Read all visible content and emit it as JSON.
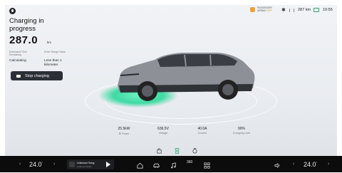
{
  "status": {
    "airbag_line1": "PASSENGER",
    "airbag_line2": "AIRBAG",
    "airbag_state": "OFF",
    "range": "287 km",
    "time": "10:55"
  },
  "charging": {
    "title": "Charging in progress",
    "range_value": "287.0",
    "range_unit": "km",
    "est_time_label": "Estimated Time Remaining",
    "est_time_value": "Calculating",
    "enter_range_label": "Enter Range Value",
    "enter_range_value": "Less than 1 kilometer",
    "stop_label": "Stop charging"
  },
  "stats": [
    {
      "value": "25.5kW",
      "label": "⚙ Power"
    },
    {
      "value": "636.5V",
      "label": "Voltage"
    },
    {
      "value": "40.0A",
      "label": "Current"
    },
    {
      "value": "90%",
      "label": "Charging Limit"
    }
  ],
  "dock": {
    "left_temp": "24.0",
    "right_temp": "24.0",
    "temp_unit": "°",
    "song": "Unknown Song",
    "artist": "Unknown Artist",
    "view_360": "360"
  },
  "colors": {
    "accent_green": "#3fd9a3",
    "airbag_off": "#e08a18",
    "dock_bg": "#0c0c0d"
  }
}
